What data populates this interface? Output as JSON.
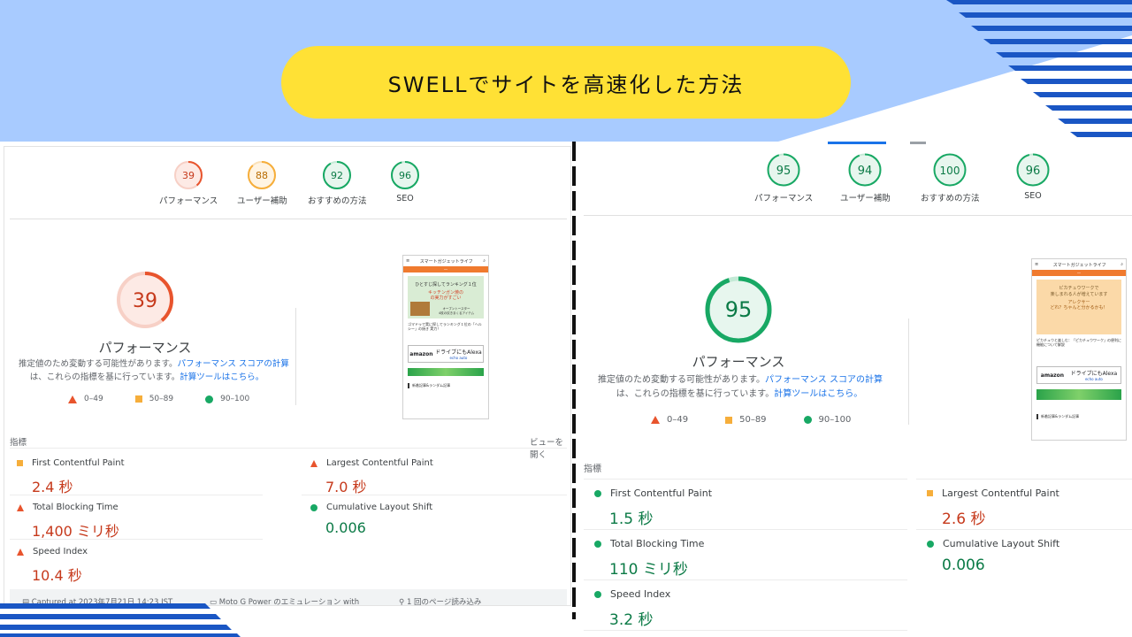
{
  "banner": {
    "title": "SWELLでサイトを高速化した方法"
  },
  "colors": {
    "sky": "#a8cbff",
    "yellow": "#ffe135",
    "stripe": "#1a56c4",
    "poor": "#e8542d",
    "average": "#f6ae3b",
    "good": "#18a864"
  },
  "left": {
    "gauges": [
      {
        "score": 39,
        "label": "パフォーマンス",
        "status": "poor"
      },
      {
        "score": 88,
        "label": "ユーザー補助",
        "status": "average"
      },
      {
        "score": 92,
        "label": "おすすめの方法",
        "status": "good"
      },
      {
        "score": 96,
        "label": "SEO",
        "status": "good"
      }
    ],
    "main_score": 39,
    "main_label": "パフォーマンス",
    "note_line1": "推定値のため変動する可能性があります。",
    "note_link1": "パフォーマンス スコアの計算",
    "note_line2": "は、これらの指標を基に行っています。",
    "note_link2": "計算ツールはこちら。",
    "legend": {
      "poor": "0–49",
      "average": "50–89",
      "good": "90–100"
    },
    "section": "指標",
    "expand": "ビューを開く",
    "metrics": [
      {
        "name": "First Contentful Paint",
        "value": "2.4 秒",
        "status": "average"
      },
      {
        "name": "Largest Contentful Paint",
        "value": "7.0 秒",
        "status": "poor"
      },
      {
        "name": "Total Blocking Time",
        "value": "1,400 ミリ秒",
        "status": "poor"
      },
      {
        "name": "Cumulative Layout Shift",
        "value": "0.006",
        "status": "good"
      },
      {
        "name": "Speed Index",
        "value": "10.4 秒",
        "status": "poor"
      }
    ],
    "footer": {
      "captured": "Captured at 2023年7月21日 14:23 JST",
      "device": "Moto G Power のエミュレーション with",
      "load": "1 回のページ読み込み"
    },
    "phone": {
      "site": "スマートガジェットライフ",
      "hero_title": "ひとすじ探してランキング１位",
      "hero_red": "キッチンガン焼の\nの実力がすごい",
      "hero_sub": "オーブントースター\n4枚の炊きまくるアイテム",
      "caption": "ゴマドゥで実に探してランキング１位の「ヘルシー」の焼き 実力！",
      "amazon": "amazon",
      "amazon_text": "ドライブにもAlexa",
      "amazon_sub": "echo auto",
      "foot": "新着記事&ランダム記事"
    }
  },
  "right": {
    "gauges": [
      {
        "score": 95,
        "label": "パフォーマンス",
        "status": "good"
      },
      {
        "score": 94,
        "label": "ユーザー補助",
        "status": "good"
      },
      {
        "score": 100,
        "label": "おすすめの方法",
        "status": "good"
      },
      {
        "score": 96,
        "label": "SEO",
        "status": "good"
      }
    ],
    "main_score": 95,
    "main_label": "パフォーマンス",
    "note_line1": "推定値のため変動する可能性があります。",
    "note_link1": "パフォーマンス スコアの計算",
    "note_line2": "は、これらの指標を基に行っています。",
    "note_link2": "計算ツールはこちら。",
    "legend": {
      "poor": "0–49",
      "average": "50–89",
      "good": "90–100"
    },
    "section": "指標",
    "metrics": [
      {
        "name": "First Contentful Paint",
        "value": "1.5 秒",
        "status": "good"
      },
      {
        "name": "Largest Contentful Paint",
        "value": "2.6 秒",
        "status": "average"
      },
      {
        "name": "Total Blocking Time",
        "value": "110 ミリ秒",
        "status": "good"
      },
      {
        "name": "Cumulative Layout Shift",
        "value": "0.006",
        "status": "good"
      },
      {
        "name": "Speed Index",
        "value": "3.2 秒",
        "status": "good"
      }
    ],
    "phone": {
      "site": "スマートガジェットライフ",
      "hero_title": "ピカチュウワークで\n楽しまれる人が増えています",
      "hero_red": "アレクサー\nどれ？ちゃんと分かるかも！",
      "caption": "ピカチュウと楽しむ：「ピカチュウワーク」の便利に機能について解説",
      "amazon": "amazon",
      "amazon_text": "ドライブにもAlexa",
      "amazon_sub": "echo auto",
      "foot": "新着記事&ランダム記事"
    }
  }
}
